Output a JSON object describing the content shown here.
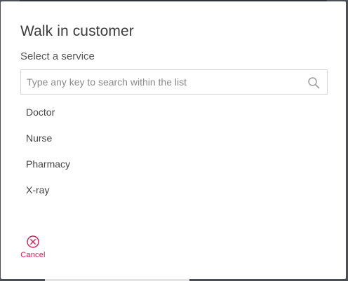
{
  "dialog": {
    "title": "Walk in customer",
    "subtitle": "Select a service"
  },
  "search": {
    "placeholder": "Type any key to search within the list",
    "value": "",
    "icon": "search-icon"
  },
  "services": [
    {
      "label": "Doctor"
    },
    {
      "label": "Nurse"
    },
    {
      "label": "Pharmacy"
    },
    {
      "label": "X-ray"
    }
  ],
  "actions": {
    "cancel_label": "Cancel",
    "cancel_icon": "close-circle-icon",
    "cancel_color": "#d81b4f"
  }
}
